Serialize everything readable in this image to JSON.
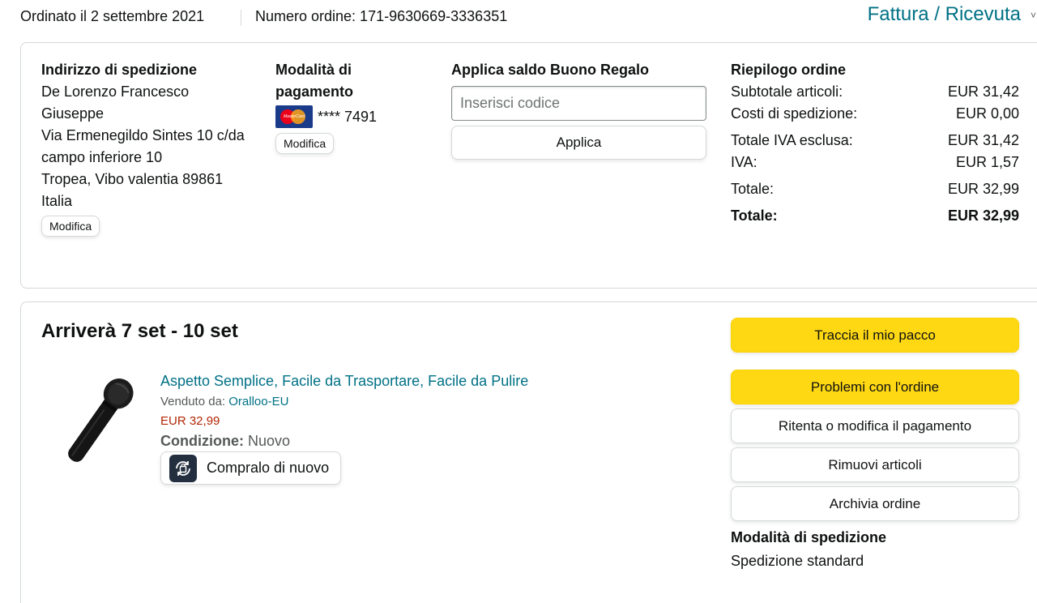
{
  "header": {
    "ordered_on": "Ordinato il 2 settembre 2021",
    "order_number": "Numero ordine: 171-9630669-3336351",
    "invoice_link": "Fattura / Ricevuta",
    "invoice_chevron": "˅"
  },
  "address": {
    "heading": "Indirizzo di spedizione",
    "lines": [
      "De Lorenzo Francesco Giuseppe",
      "Via Ermenegildo Sintes 10 c/da campo inferiore 10",
      "Tropea, Vibo valentia 89861",
      "Italia"
    ],
    "edit_label": "Modifica"
  },
  "payment": {
    "heading": "Modalità di pagamento",
    "card_brand_label": "MasterCard",
    "card_icon": "mastercard-icon",
    "card_masked": "**** 7491",
    "edit_label": "Modifica"
  },
  "gift": {
    "heading": "Applica saldo Buono Regalo",
    "placeholder": "Inserisci codice",
    "apply_label": "Applica"
  },
  "summary": {
    "heading": "Riepilogo ordine",
    "rows": [
      {
        "label": "Subtotale articoli:",
        "value": "EUR 31,42"
      },
      {
        "label": "Costi di spedizione:",
        "value": "EUR 0,00"
      },
      {
        "label": "Totale IVA esclusa:",
        "value": "EUR 31,42"
      },
      {
        "label": "IVA:",
        "value": "EUR 1,57"
      },
      {
        "label": "Totale:",
        "value": "EUR 32,99"
      },
      {
        "label": "Totale:",
        "value": "EUR 32,99"
      }
    ]
  },
  "shipment": {
    "arrival": "Arriverà 7 set - 10 set",
    "product_title": "Aspetto Semplice, Facile da Trasportare, Facile da Pulire",
    "sold_by_label": "Venduto da:",
    "seller": "Oralloo-EU",
    "price": "EUR 32,99",
    "condition_label": "Condizione:",
    "condition_value": "Nuovo",
    "rebuy_label": "Compralo di nuovo",
    "rebuy_icon": "buy-again-icon"
  },
  "actions": {
    "track": "Traccia il mio pacco",
    "problems": "Problemi con l'ordine",
    "retry_payment": "Ritenta o modifica il pagamento",
    "remove_items": "Rimuovi articoli",
    "archive": "Archivia ordine",
    "shipping_method_heading": "Modalità di spedizione",
    "shipping_method": "Spedizione standard"
  },
  "colors": {
    "link": "#007185",
    "price": "#b12704",
    "primary_button": "#ffd814",
    "border": "#d5d9d9"
  }
}
